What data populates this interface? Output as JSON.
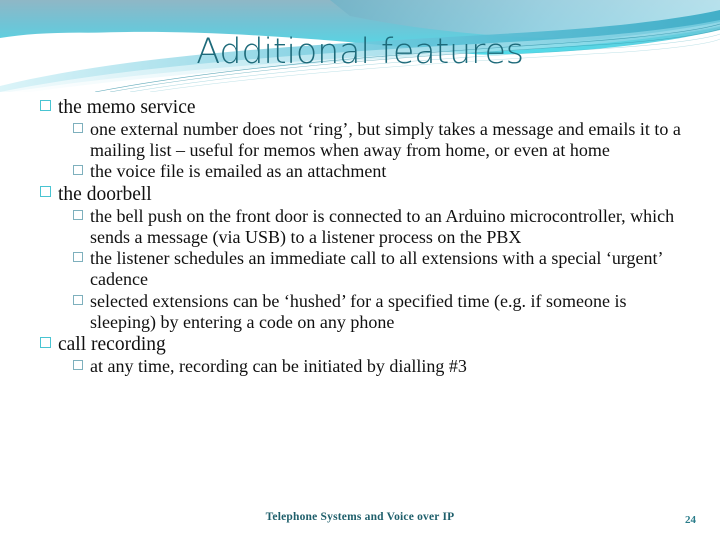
{
  "slide": {
    "title": "Additional features",
    "theme": {
      "title_color": "#1d6a7a",
      "bullet_level1_color": "#49c4d2",
      "bullet_level2_color": "#7eb0bd",
      "body_text_color": "#101010",
      "footer_color": "#1f5f6b",
      "header_band_top": "#7fb4c6",
      "header_band_bottom": "#4fd8e6",
      "header_wave_teal": "#3fb6cc",
      "header_wave_light": "#a9e4ef"
    },
    "bullets": [
      {
        "level": 1,
        "text": "the memo service",
        "bullet_icon": "hollow-square-bullet",
        "children": [
          {
            "level": 2,
            "bullet_icon": "hollow-square-bullet",
            "text": "one external number does not ‘ring’, but simply takes a message and emails it to a mailing list – useful for memos when away from home, or even at home"
          },
          {
            "level": 2,
            "bullet_icon": "hollow-square-bullet",
            "text": "the voice file is emailed as an attachment"
          }
        ]
      },
      {
        "level": 1,
        "text": "the doorbell",
        "bullet_icon": "hollow-square-bullet",
        "children": [
          {
            "level": 2,
            "bullet_icon": "hollow-square-bullet",
            "text": "the bell push on the front door is connected to an Arduino microcontroller, which sends a message (via USB) to a listener process on the PBX"
          },
          {
            "level": 2,
            "bullet_icon": "hollow-square-bullet",
            "text": "the listener schedules an immediate call to all extensions with a special ‘urgent’ cadence"
          },
          {
            "level": 2,
            "bullet_icon": "hollow-square-bullet",
            "text": "selected extensions can be ‘hushed’ for a specified time (e.g. if someone is sleeping) by entering a code on any phone"
          }
        ]
      },
      {
        "level": 1,
        "text": "call recording",
        "bullet_icon": "hollow-square-bullet",
        "children": [
          {
            "level": 2,
            "bullet_icon": "hollow-square-bullet",
            "text": "at any time, recording can be initiated by dialling #3"
          }
        ]
      }
    ],
    "footer": {
      "title": "Telephone Systems and Voice over IP",
      "page_number": "24"
    }
  }
}
